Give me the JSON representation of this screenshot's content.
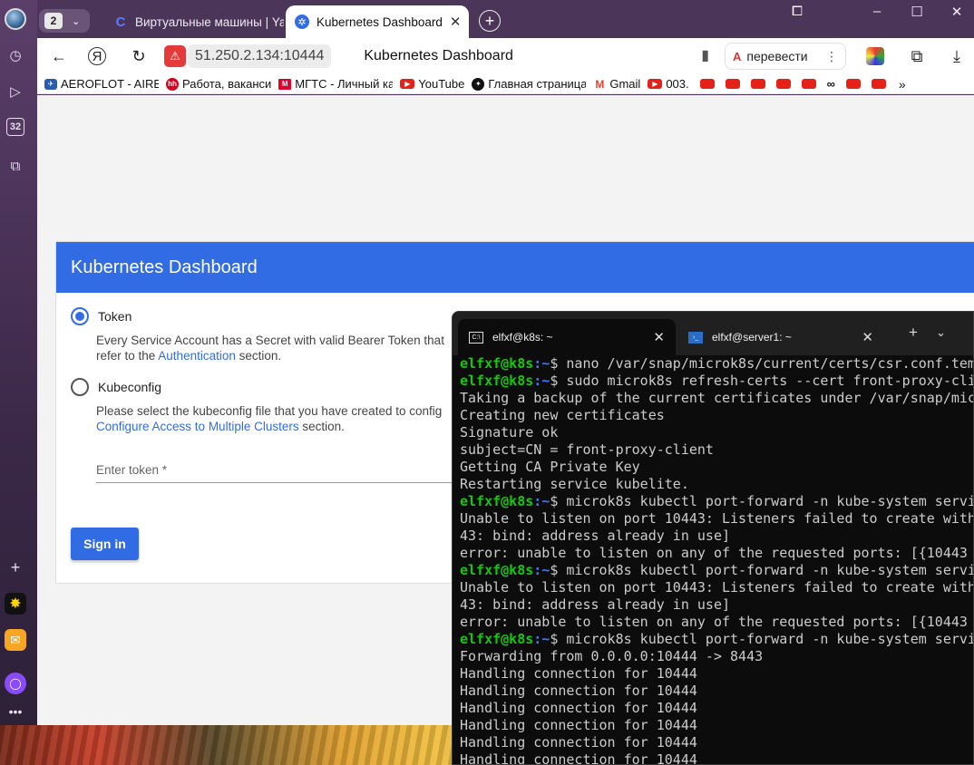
{
  "browser": {
    "tab_count": "2",
    "tabs": [
      {
        "label": "Виртуальные машины | Ya",
        "active": false
      },
      {
        "label": "Kubernetes Dashboard",
        "active": true
      }
    ],
    "address": {
      "host": "51.250.2.134:10444",
      "title": "Kubernetes Dashboard"
    },
    "translate_label": "перевести",
    "bookmarks": [
      {
        "label": "AEROFLOT - AIRE",
        "icon_color": "#2a5db0"
      },
      {
        "label": "Работа, ваканси",
        "icon_color": "#d6001c",
        "icon_text": "hh"
      },
      {
        "label": "МГТС - Личный ка",
        "icon_color": "#e4002b",
        "icon_text": "М"
      },
      {
        "label": "YouTube",
        "icon_color": "#e62117"
      },
      {
        "label": "Главная страница",
        "icon_color": "#111111"
      },
      {
        "label": "Gmail",
        "icon_color": "#ea4335",
        "icon_text": "M"
      },
      {
        "label": "003.",
        "icon_color": "#e62117"
      }
    ],
    "bookmarks_overflow": "»"
  },
  "left_rail": {
    "badge": "32"
  },
  "dashboard": {
    "header": "Kubernetes Dashboard",
    "token_option": {
      "label": "Token",
      "desc_1": "Every Service Account has a Secret with valid Bearer Token that",
      "desc_2_prefix": "refer to the ",
      "desc_2_link": "Authentication",
      "desc_2_suffix": " section."
    },
    "kubeconfig_option": {
      "label": "Kubeconfig",
      "desc_1": "Please select the kubeconfig file that you have created to config",
      "desc_2_link": "Configure Access to Multiple Clusters",
      "desc_2_suffix": " section."
    },
    "token_placeholder": "Enter token *",
    "signin_label": "Sign in"
  },
  "terminal": {
    "tabs": [
      {
        "label": "elfxf@k8s: ~",
        "active": true
      },
      {
        "label": "elfxf@server1: ~",
        "active": false
      }
    ],
    "prompt_user": "elfxf@k8s",
    "prompt_path": ":~",
    "lines": [
      {
        "prompt": true,
        "cmd": "$ nano /var/snap/microk8s/current/certs/csr.conf.tem"
      },
      {
        "prompt": true,
        "cmd": "$ sudo microk8s refresh-certs --cert front-proxy-cli"
      },
      {
        "prompt": false,
        "text": "Taking a backup of the current certificates under /var/snap/mic"
      },
      {
        "prompt": false,
        "text": "Creating new certificates"
      },
      {
        "prompt": false,
        "text": "Signature ok"
      },
      {
        "prompt": false,
        "text": "subject=CN = front-proxy-client"
      },
      {
        "prompt": false,
        "text": "Getting CA Private Key"
      },
      {
        "prompt": false,
        "text": "Restarting service kubelite."
      },
      {
        "prompt": true,
        "cmd": "$ microk8s kubectl port-forward -n kube-system servi"
      },
      {
        "prompt": false,
        "text": "Unable to listen on port 10443: Listeners failed to create with"
      },
      {
        "prompt": false,
        "text": "43: bind: address already in use]"
      },
      {
        "prompt": false,
        "text": "error: unable to listen on any of the requested ports: [{10443"
      },
      {
        "prompt": true,
        "cmd": "$ microk8s kubectl port-forward -n kube-system servi"
      },
      {
        "prompt": false,
        "text": "Unable to listen on port 10443: Listeners failed to create with"
      },
      {
        "prompt": false,
        "text": "43: bind: address already in use]"
      },
      {
        "prompt": false,
        "text": "error: unable to listen on any of the requested ports: [{10443"
      },
      {
        "prompt": true,
        "cmd": "$ microk8s kubectl port-forward -n kube-system servi"
      },
      {
        "prompt": false,
        "text": "Forwarding from 0.0.0.0:10444 -> 8443"
      },
      {
        "prompt": false,
        "text": "Handling connection for 10444"
      },
      {
        "prompt": false,
        "text": "Handling connection for 10444"
      },
      {
        "prompt": false,
        "text": "Handling connection for 10444"
      },
      {
        "prompt": false,
        "text": "Handling connection for 10444"
      },
      {
        "prompt": false,
        "text": "Handling connection for 10444"
      },
      {
        "prompt": false,
        "text": "Handling connection for 10444"
      }
    ]
  }
}
